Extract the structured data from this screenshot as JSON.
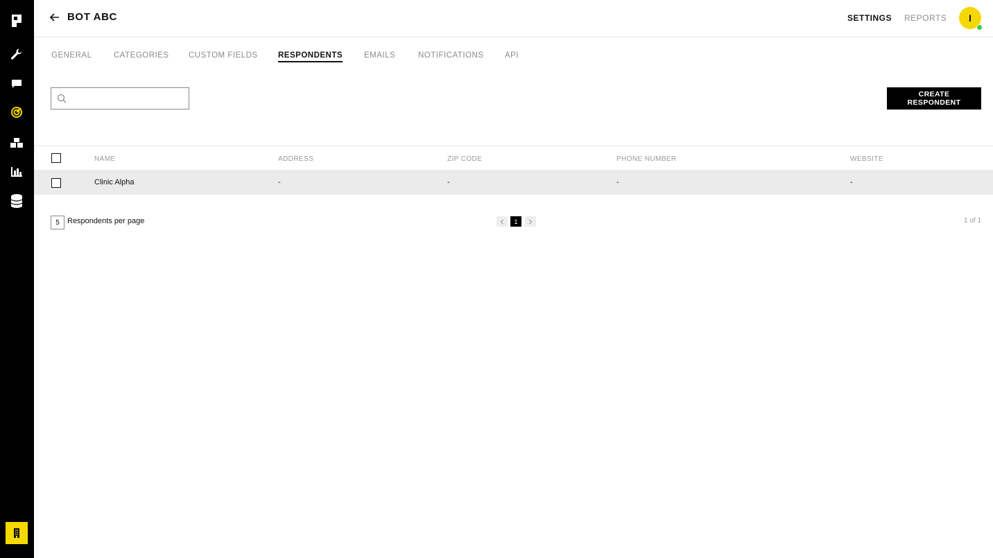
{
  "header": {
    "title": "BOT ABC",
    "nav": {
      "settings": "SETTINGS",
      "reports": "REPORTS"
    },
    "avatar_initial": "I"
  },
  "sidebar": {
    "icons": [
      "logo-icon",
      "wrench-icon",
      "chat-icon",
      "target-icon",
      "blocks-icon",
      "bar-chart-icon",
      "database-icon"
    ],
    "bottom_icon": "building-icon",
    "accent_color": "#f5d800"
  },
  "tabs": [
    {
      "label": "GENERAL"
    },
    {
      "label": "CATEGORIES"
    },
    {
      "label": "CUSTOM FIELDS"
    },
    {
      "label": "RESPONDENTS",
      "active": true
    },
    {
      "label": "EMAILS"
    },
    {
      "label": "NOTIFICATIONS"
    },
    {
      "label": "API"
    }
  ],
  "search": {
    "placeholder": "",
    "value": ""
  },
  "actions": {
    "create": "CREATE RESPONDENT"
  },
  "table": {
    "columns": [
      "NAME",
      "ADDRESS",
      "ZIP CODE",
      "PHONE NUMBER",
      "WEBSITE"
    ],
    "rows": [
      {
        "name": "Clinic Alpha",
        "address": "-",
        "zip": "-",
        "phone": "-",
        "website": "-"
      }
    ]
  },
  "pagination": {
    "per_page": "5",
    "per_page_label": "Respondents per page",
    "current_page": "1",
    "summary": "1 of 1"
  }
}
